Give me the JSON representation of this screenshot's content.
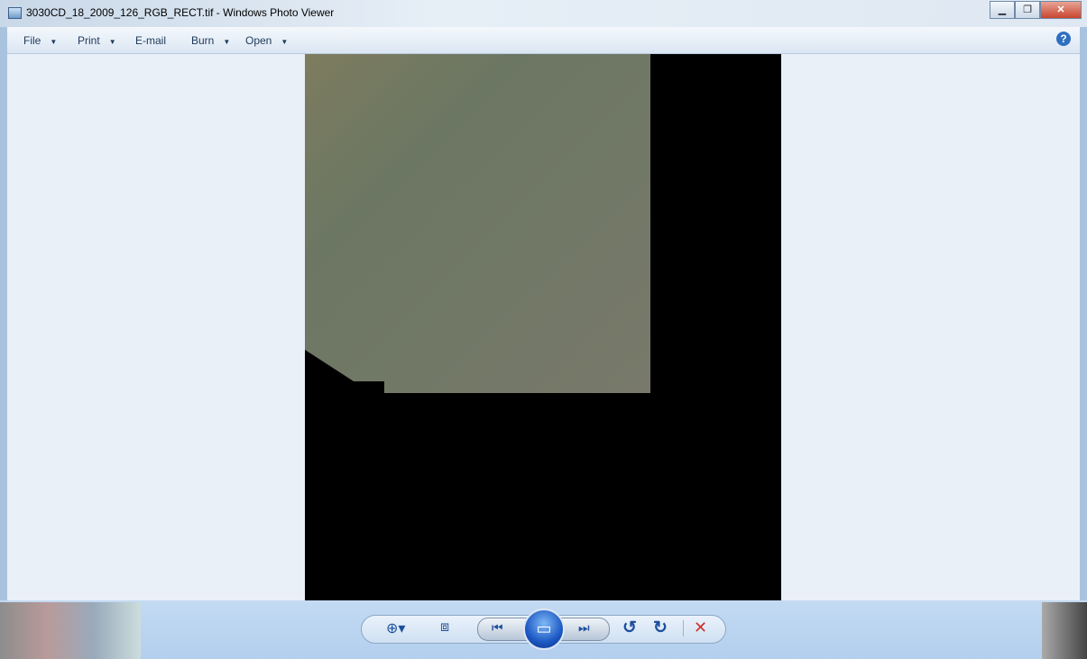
{
  "window": {
    "title": "3030CD_18_2009_126_RGB_RECT.tif - Windows Photo Viewer",
    "minimize": "▁",
    "maximize": "❐",
    "close": "✕"
  },
  "menu": [
    {
      "label": "File",
      "dropdown": true
    },
    {
      "label": "Print",
      "dropdown": true
    },
    {
      "label": "E-mail",
      "dropdown": false
    },
    {
      "label": "Burn",
      "dropdown": true
    },
    {
      "label": "Open",
      "dropdown": true
    }
  ],
  "help": "?",
  "controls": {
    "zoom": "⊕▾",
    "fit": "⧈",
    "prev": "⏮",
    "slideshow": "▭",
    "next": "⏭",
    "rotate_ccw": "↺",
    "rotate_cw": "↻",
    "delete": "✕"
  },
  "colors": {
    "photo": "#6f7a63",
    "delete": "#d0302a"
  }
}
